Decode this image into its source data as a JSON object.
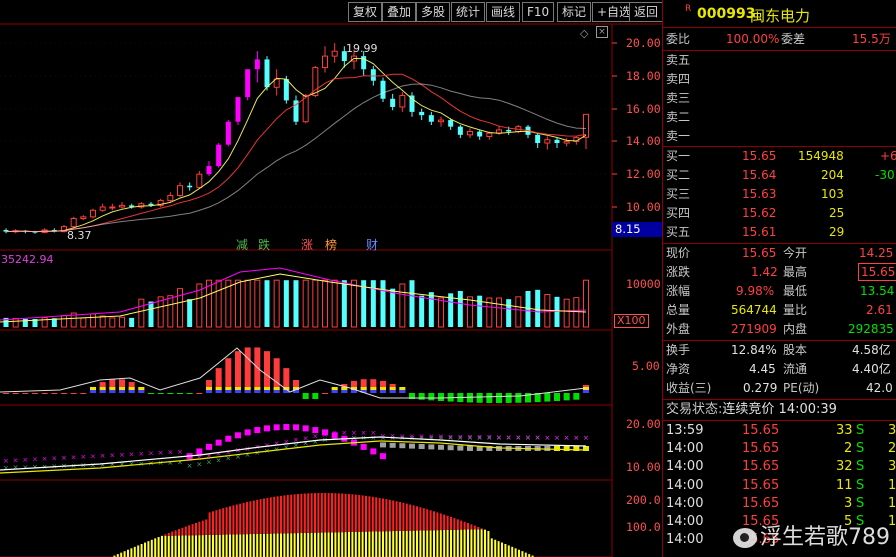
{
  "toolbar": {
    "buttons": [
      "复权",
      "叠加",
      "多股",
      "统计",
      "画线",
      "F10",
      "标记",
      "+自选",
      "返回"
    ]
  },
  "stock": {
    "badge": "R",
    "code": "000993",
    "name": "闽东电力"
  },
  "price_axis": [
    "20.00",
    "18.00",
    "16.00",
    "14.00",
    "12.00",
    "10.00"
  ],
  "crosshair_price": "8.15",
  "annotations": {
    "high": "19.99",
    "low": "8.37",
    "events": [
      "减",
      "跌",
      "涨",
      "榜",
      "财"
    ]
  },
  "volume": {
    "label": "35242.94",
    "axis": "10000",
    "unit": "X100"
  },
  "macd_axis": "5.00",
  "kdj_axis": [
    "20.00",
    "10.00"
  ],
  "bottom_axis": [
    "200.0",
    "100.0"
  ],
  "order_book": {
    "weibi_label": "委比",
    "weibi": "100.00%",
    "weicha_label": "委差",
    "weicha": "15.5万",
    "sells": [
      "卖五",
      "卖四",
      "卖三",
      "卖二",
      "卖一"
    ],
    "buys": [
      {
        "label": "买一",
        "price": "15.65",
        "vol": "154948",
        "chg": "+6"
      },
      {
        "label": "买二",
        "price": "15.64",
        "vol": "204",
        "chg": "-30"
      },
      {
        "label": "买三",
        "price": "15.63",
        "vol": "103",
        "chg": ""
      },
      {
        "label": "买四",
        "price": "15.62",
        "vol": "25",
        "chg": ""
      },
      {
        "label": "买五",
        "price": "15.61",
        "vol": "29",
        "chg": ""
      }
    ]
  },
  "quote": {
    "rows": [
      {
        "l1": "现价",
        "v1": "15.65",
        "l2": "今开",
        "v2": "14.25"
      },
      {
        "l1": "涨跌",
        "v1": "1.42",
        "l2": "最高",
        "v2": "15.65"
      },
      {
        "l1": "涨幅",
        "v1": "9.98%",
        "l2": "最低",
        "v2": "13.54"
      },
      {
        "l1": "总量",
        "v1": "564744",
        "l2": "量比",
        "v2": "2.61"
      },
      {
        "l1": "外盘",
        "v1": "271909",
        "l2": "内盘",
        "v2": "292835"
      }
    ],
    "rows2": [
      {
        "l1": "换手",
        "v1": "12.84%",
        "l2": "股本",
        "v2": "4.58亿"
      },
      {
        "l1": "净资",
        "v1": "4.45",
        "l2": "流通",
        "v2": "4.40亿"
      },
      {
        "l1": "收益(三)",
        "v1": "0.279",
        "l2": "PE(动)",
        "v2": "42.0"
      }
    ]
  },
  "trade_status": {
    "label": "交易状态:",
    "value": "连续竞价",
    "time": "14:00:39"
  },
  "ticks": [
    {
      "time": "13:59",
      "price": "15.65",
      "vol": "33",
      "side": "S",
      "n": "3"
    },
    {
      "time": "14:00",
      "price": "15.65",
      "vol": "2",
      "side": "S",
      "n": "2"
    },
    {
      "time": "14:00",
      "price": "15.65",
      "vol": "32",
      "side": "S",
      "n": "3"
    },
    {
      "time": "14:00",
      "price": "15.65",
      "vol": "11",
      "side": "S",
      "n": "1"
    },
    {
      "time": "14:00",
      "price": "15.65",
      "vol": "3",
      "side": "S",
      "n": "1"
    },
    {
      "time": "14:00",
      "price": "15.65",
      "vol": "5",
      "side": "S",
      "n": "1"
    },
    {
      "time": "14:00",
      "price": "15.65",
      "vol": "",
      "side": "",
      "n": ""
    }
  ],
  "watermark": "浮生若歌789",
  "chart_data": {
    "type": "candlestick",
    "y_unit": "price",
    "ylim": [
      8,
      20.5
    ],
    "candles": [
      [
        8.6,
        8.5,
        8.7,
        8.4
      ],
      [
        8.5,
        8.55,
        8.65,
        8.4
      ],
      [
        8.55,
        8.5,
        8.6,
        8.4
      ],
      [
        8.5,
        8.45,
        8.55,
        8.37
      ],
      [
        8.45,
        8.6,
        8.7,
        8.4
      ],
      [
        8.6,
        8.5,
        8.7,
        8.45
      ],
      [
        8.5,
        8.8,
        8.9,
        8.45
      ],
      [
        8.8,
        9.3,
        9.4,
        8.75
      ],
      [
        9.3,
        9.4,
        9.5,
        9.2
      ],
      [
        9.4,
        9.8,
        9.9,
        9.3
      ],
      [
        9.8,
        10.0,
        10.2,
        9.7
      ],
      [
        10.0,
        10.0,
        10.2,
        9.8
      ],
      [
        10.0,
        10.1,
        10.3,
        9.9
      ],
      [
        10.1,
        10.0,
        10.2,
        9.9
      ],
      [
        10.0,
        10.2,
        10.3,
        9.9
      ],
      [
        10.2,
        10.1,
        10.3,
        10.0
      ],
      [
        10.1,
        10.4,
        10.5,
        10.0
      ],
      [
        10.4,
        10.7,
        10.9,
        10.3
      ],
      [
        10.7,
        11.3,
        11.5,
        10.6
      ],
      [
        11.3,
        11.2,
        11.5,
        11.0
      ],
      [
        11.2,
        12.0,
        12.2,
        11.1
      ],
      [
        12.0,
        12.5,
        12.8,
        11.9
      ],
      [
        12.5,
        13.8,
        13.9,
        12.4
      ],
      [
        13.8,
        15.2,
        15.3,
        13.7
      ],
      [
        15.2,
        16.7,
        16.7,
        15.0
      ],
      [
        16.7,
        18.4,
        18.4,
        16.5
      ],
      [
        18.4,
        19.0,
        19.5,
        17.6
      ],
      [
        19.0,
        17.3,
        19.2,
        17.1
      ],
      [
        17.3,
        17.8,
        18.4,
        16.8
      ],
      [
        17.8,
        16.5,
        18.0,
        16.3
      ],
      [
        16.5,
        15.2,
        16.8,
        15.0
      ],
      [
        15.2,
        16.8,
        16.9,
        15.1
      ],
      [
        16.8,
        18.5,
        18.6,
        16.7
      ],
      [
        18.5,
        19.2,
        19.8,
        18.2
      ],
      [
        19.2,
        19.5,
        19.99,
        18.8
      ],
      [
        19.5,
        18.9,
        19.8,
        18.5
      ],
      [
        18.9,
        19.2,
        19.6,
        18.4
      ],
      [
        19.2,
        18.4,
        19.5,
        18.0
      ],
      [
        18.4,
        17.7,
        18.6,
        17.4
      ],
      [
        17.7,
        16.6,
        17.9,
        16.4
      ],
      [
        16.6,
        16.1,
        16.9,
        15.9
      ],
      [
        16.1,
        16.8,
        17.0,
        15.8
      ],
      [
        16.8,
        15.8,
        17.0,
        15.5
      ],
      [
        15.8,
        15.6,
        16.0,
        15.3
      ],
      [
        15.6,
        15.2,
        15.8,
        15.0
      ],
      [
        15.2,
        15.3,
        15.5,
        14.9
      ],
      [
        15.3,
        14.9,
        15.4,
        14.7
      ],
      [
        14.9,
        14.4,
        15.0,
        14.2
      ],
      [
        14.4,
        14.6,
        14.8,
        14.2
      ],
      [
        14.6,
        14.3,
        14.7,
        14.1
      ],
      [
        14.3,
        14.5,
        14.6,
        14.1
      ],
      [
        14.5,
        14.7,
        14.9,
        14.4
      ],
      [
        14.7,
        14.6,
        14.9,
        14.4
      ],
      [
        14.6,
        14.9,
        15.0,
        14.5
      ],
      [
        14.9,
        14.4,
        15.0,
        14.2
      ],
      [
        14.4,
        13.9,
        14.5,
        13.6
      ],
      [
        13.9,
        14.1,
        14.3,
        13.5
      ],
      [
        14.1,
        13.9,
        14.2,
        13.6
      ],
      [
        13.9,
        14.0,
        14.2,
        13.7
      ],
      [
        14.0,
        14.23,
        14.3,
        13.8
      ],
      [
        14.25,
        15.65,
        15.65,
        13.54
      ]
    ]
  }
}
